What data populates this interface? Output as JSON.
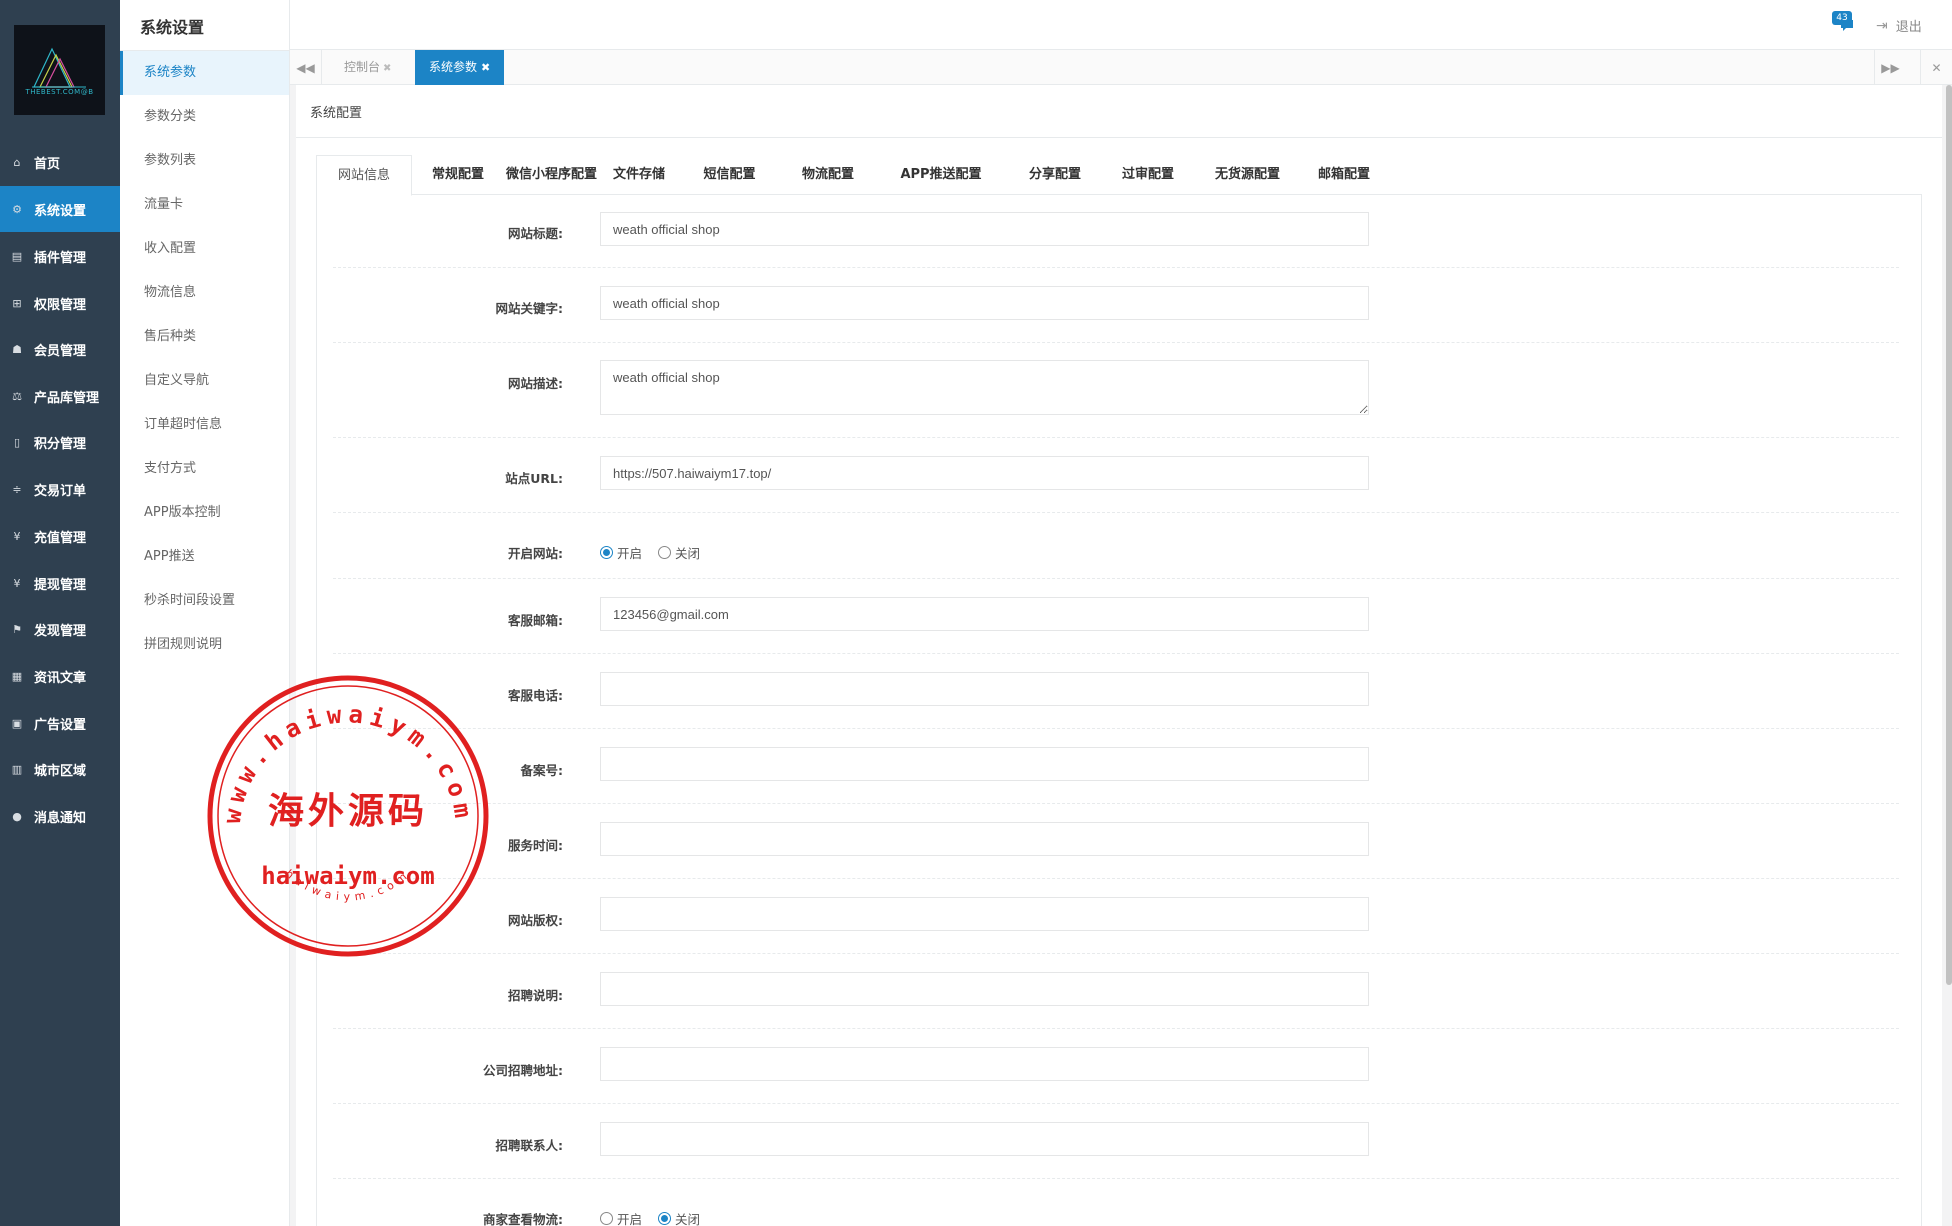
{
  "logo": {
    "text": "THEBEST.COM@B"
  },
  "nav": [
    {
      "label": "首页",
      "icon": "home-icon",
      "glyph": "⌂"
    },
    {
      "label": "系统设置",
      "icon": "gear-icon",
      "glyph": "⚙",
      "active": true
    },
    {
      "label": "插件管理",
      "icon": "plugin-icon",
      "glyph": "▤"
    },
    {
      "label": "权限管理",
      "icon": "sitemap-icon",
      "glyph": "⊞"
    },
    {
      "label": "会员管理",
      "icon": "users-icon",
      "glyph": "☗"
    },
    {
      "label": "产品库管理",
      "icon": "balance-icon",
      "glyph": "⚖"
    },
    {
      "label": "积分管理",
      "icon": "file-icon",
      "glyph": "▯"
    },
    {
      "label": "交易订单",
      "icon": "money-icon",
      "glyph": "≑"
    },
    {
      "label": "充值管理",
      "icon": "yen-icon",
      "glyph": "¥"
    },
    {
      "label": "提现管理",
      "icon": "yen-icon",
      "glyph": "¥"
    },
    {
      "label": "发现管理",
      "icon": "flag-icon",
      "glyph": "⚑"
    },
    {
      "label": "资讯文章",
      "icon": "newspaper-icon",
      "glyph": "▦"
    },
    {
      "label": "广告设置",
      "icon": "image-icon",
      "glyph": "▣"
    },
    {
      "label": "城市区域",
      "icon": "map-icon",
      "glyph": "▥"
    },
    {
      "label": "消息通知",
      "icon": "comment-icon",
      "glyph": "●"
    }
  ],
  "submenu": {
    "title": "系统设置",
    "items": [
      {
        "label": "系统参数",
        "active": true
      },
      {
        "label": "参数分类"
      },
      {
        "label": "参数列表"
      },
      {
        "label": "流量卡"
      },
      {
        "label": "收入配置"
      },
      {
        "label": "物流信息"
      },
      {
        "label": "售后种类"
      },
      {
        "label": "自定义导航"
      },
      {
        "label": "订单超时信息"
      },
      {
        "label": "支付方式"
      },
      {
        "label": "APP版本控制"
      },
      {
        "label": "APP推送"
      },
      {
        "label": "秒杀时间段设置"
      },
      {
        "label": "拼团规则说明"
      }
    ]
  },
  "topbar": {
    "notification_count": "43",
    "logout_label": "退出"
  },
  "page_tabs": {
    "console": "控制台",
    "current": "系统参数"
  },
  "content": {
    "title": "系统配置",
    "config_tabs": [
      "网站信息",
      "常规配置",
      "微信小程序配置",
      "文件存储",
      "短信配置",
      "物流配置",
      "APP推送配置",
      "分享配置",
      "过审配置",
      "无货源配置",
      "邮箱配置"
    ],
    "form": {
      "site_title": {
        "label": "网站标题:",
        "value": "weath official shop"
      },
      "site_keywords": {
        "label": "网站关键字:",
        "value": "weath official shop"
      },
      "site_desc": {
        "label": "网站描述:",
        "value": "weath official shop"
      },
      "site_url": {
        "label": "站点URL:",
        "value": "https://507.haiwaiym17.top/"
      },
      "site_open": {
        "label": "开启网站:",
        "on": "开启",
        "off": "关闭",
        "selected": "开启"
      },
      "service_email": {
        "label": "客服邮箱:",
        "value": "123456@gmail.com"
      },
      "service_phone": {
        "label": "客服电话:",
        "value": ""
      },
      "icp": {
        "label": "备案号:",
        "value": ""
      },
      "service_time": {
        "label": "服务时间:",
        "value": ""
      },
      "copyright": {
        "label": "网站版权:",
        "value": ""
      },
      "recruit_desc": {
        "label": "招聘说明:",
        "value": ""
      },
      "recruit_addr": {
        "label": "公司招聘地址:",
        "value": ""
      },
      "recruit_contact": {
        "label": "招聘联系人:",
        "value": ""
      },
      "merchant_logistics": {
        "label": "商家查看物流:",
        "on": "开启",
        "off": "关闭",
        "selected": "关闭"
      }
    }
  },
  "stamp": {
    "outer_text": "www.haiwaiym.com",
    "center_text": "海外源码",
    "domain_text": "haiwaiym.com",
    "inner_text": "haiwaiym.com",
    "color": "#e02020"
  },
  "colors": {
    "nav_bg": "#2f4050",
    "accent": "#1c84c6"
  }
}
